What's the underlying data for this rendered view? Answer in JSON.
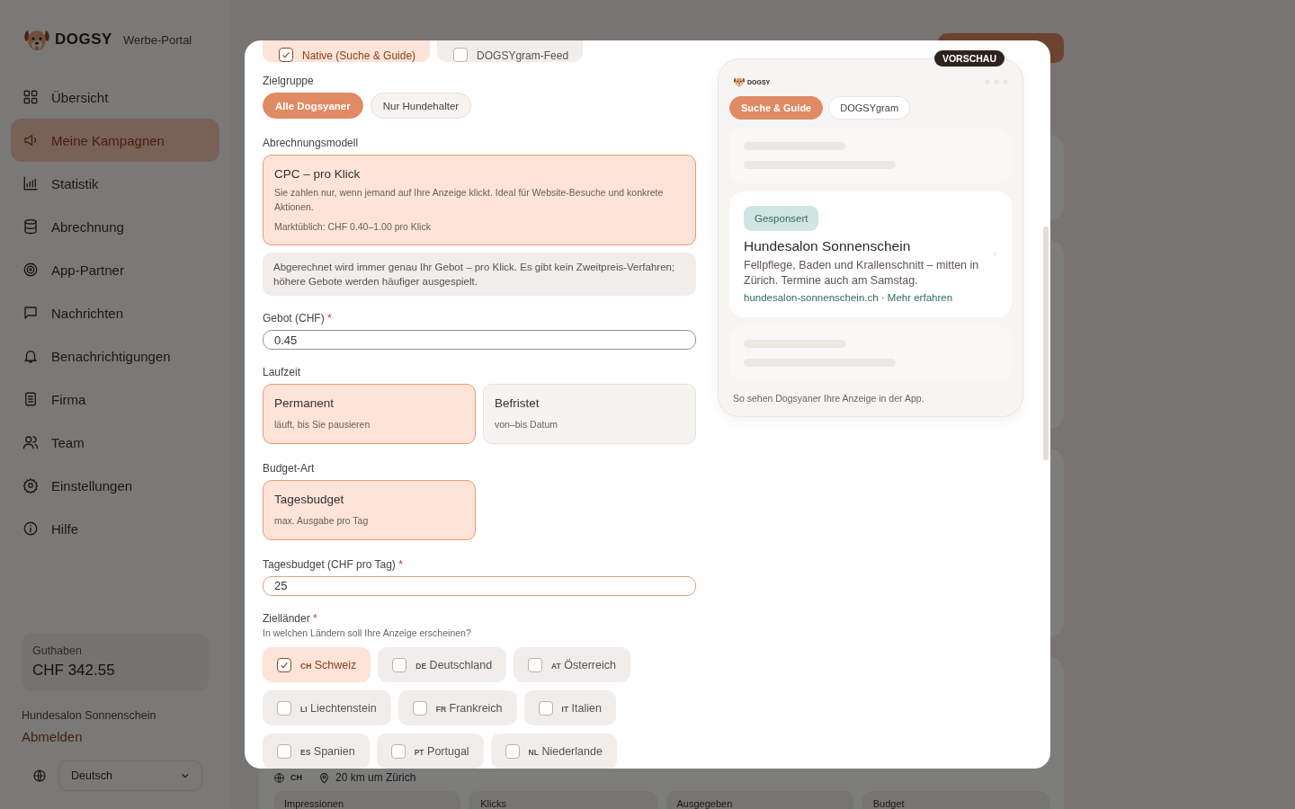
{
  "sidebar": {
    "brand": "DOGSY",
    "subtitle": "Werbe-Portal",
    "items": [
      {
        "label": "Übersicht",
        "selected": false
      },
      {
        "label": "Meine Kampagnen",
        "selected": true
      },
      {
        "label": "Statistik",
        "selected": false
      },
      {
        "label": "Abrechnung",
        "selected": false
      },
      {
        "label": "App-Partner",
        "selected": false
      },
      {
        "label": "Nachrichten",
        "selected": false
      },
      {
        "label": "Benachrichtigungen",
        "selected": false
      },
      {
        "label": "Firma",
        "selected": false
      },
      {
        "label": "Team",
        "selected": false
      },
      {
        "label": "Einstellungen",
        "selected": false
      },
      {
        "label": "Hilfe",
        "selected": false
      }
    ],
    "balance": {
      "label": "Guthaben",
      "amount": "CHF 342.55"
    },
    "account_name": "Hundesalon Sonnenschein",
    "logout": "Abmelden",
    "language": "Deutsch"
  },
  "background": {
    "country": "CH",
    "place": "20 km um Zürich",
    "stats": [
      "Impressionen",
      "Klicks",
      "Ausgegeben",
      "Budget"
    ]
  },
  "modal": {
    "placements": [
      {
        "label": "Native (Suche & Guide)",
        "checked": true
      },
      {
        "label": "DOGSYgram-Feed",
        "checked": false
      }
    ],
    "audience": {
      "label": "Zielgruppe",
      "options": [
        {
          "label": "Alle Dogsyaner",
          "selected": true
        },
        {
          "label": "Nur Hundehalter",
          "selected": false
        }
      ]
    },
    "billing": {
      "label": "Abrechnungsmodell",
      "options": [
        {
          "title": "CPC – pro Klick",
          "description": "Sie zahlen nur, wenn jemand auf Ihre Anzeige klickt. Ideal für Website-Besuche und konkrete Aktionen.",
          "note": "Marktüblich: CHF 0.40–1.00 pro Klick",
          "selected": true
        }
      ],
      "info": "Abgerechnet wird immer genau Ihr Gebot – pro Klick. Es gibt kein Zweitpreis-Verfahren; höhere Gebote werden häufiger ausgespielt."
    },
    "bid": {
      "label": "Gebot (CHF)",
      "mark": "*",
      "value": "0.45"
    },
    "duration": {
      "label": "Laufzeit",
      "options": [
        {
          "title": "Permanent",
          "subtitle": "läuft, bis Sie pausieren",
          "selected": true
        },
        {
          "title": "Befristet",
          "subtitle": "von–bis Datum",
          "selected": false
        }
      ]
    },
    "budget_type": {
      "label": "Budget-Art",
      "options": [
        {
          "title": "Tagesbudget",
          "subtitle": "max. Ausgabe pro Tag",
          "selected": true
        }
      ]
    },
    "daily_budget": {
      "label": "Tagesbudget (CHF pro Tag)",
      "mark": "*",
      "value": "25"
    },
    "countries": {
      "label": "Zielländer",
      "mark": "*",
      "hint": "In welchen Ländern soll Ihre Anzeige erscheinen?",
      "options": [
        {
          "code": "CH",
          "name": "Schweiz",
          "checked": true
        },
        {
          "code": "DE",
          "name": "Deutschland",
          "checked": false
        },
        {
          "code": "AT",
          "name": "Österreich",
          "checked": false
        },
        {
          "code": "LI",
          "name": "Liechtenstein",
          "checked": false
        },
        {
          "code": "FR",
          "name": "Frankreich",
          "checked": false
        },
        {
          "code": "IT",
          "name": "Italien",
          "checked": false
        },
        {
          "code": "ES",
          "name": "Spanien",
          "checked": false
        },
        {
          "code": "PT",
          "name": "Portugal",
          "checked": false
        },
        {
          "code": "NL",
          "name": "Niederlande",
          "checked": false
        }
      ]
    }
  },
  "preview": {
    "badge": "VORSCHAU",
    "brand": "DOGSY",
    "tabs": [
      {
        "label": "Suche & Guide",
        "selected": true
      },
      {
        "label": "DOGSYgram",
        "selected": false
      }
    ],
    "ad": {
      "tag": "Gesponsert",
      "title": "Hundesalon Sonnenschein",
      "text": "Fellpflege, Baden und Krallenschnitt – mitten in Zürich. Termine auch am Samstag.",
      "link": "hundesalon-sonnenschein.ch · Mehr erfahren"
    },
    "caption": "So sehen Dogsyaner Ihre Anzeige in der App."
  }
}
